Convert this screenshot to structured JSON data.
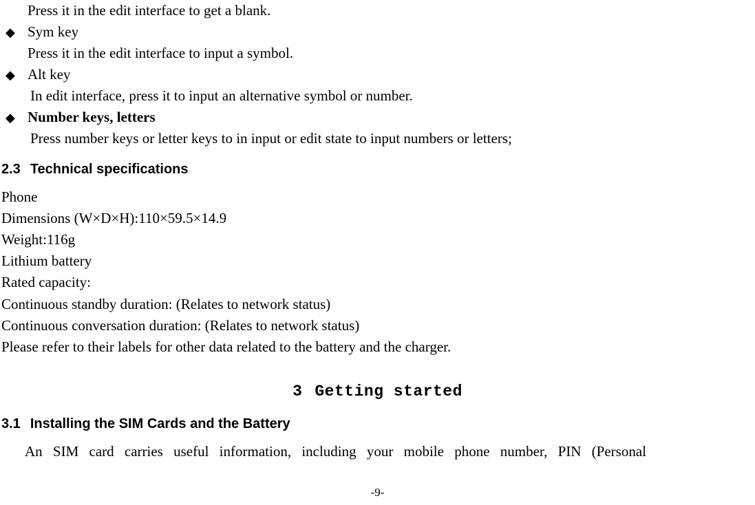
{
  "items": {
    "prev_desc": "Press it in the edit interface to get a blank.",
    "sym_key": {
      "title": "Sym key",
      "desc": "Press it in the edit interface to input a symbol."
    },
    "alt_key": {
      "title": "Alt key",
      "desc": "In edit interface, press it to input an alternative symbol or number."
    },
    "number_keys": {
      "title": "Number keys, letters",
      "desc": "Press number keys or letter keys to in input or edit state to input numbers or letters;"
    }
  },
  "section_2_3": {
    "num": "2.3",
    "title": "Technical specifications",
    "lines": {
      "phone": "Phone",
      "dims": "Dimensions (W×D×H):110×59.5×14.9",
      "weight": "Weight:116g",
      "battery": "Lithium battery",
      "capacity": "Rated capacity:",
      "standby": "Continuous standby duration: (Relates to network status)",
      "conversation": "Continuous conversation duration: (Relates to network status)",
      "refer": "Please refer to their labels for other data related to the battery and the charger."
    }
  },
  "chapter_3": {
    "num": "3",
    "title": "Getting started"
  },
  "section_3_1": {
    "num": "3.1",
    "title": "Installing the SIM Cards and the Battery",
    "body": "An SIM card carries useful information, including your mobile phone number, PIN (Personal"
  },
  "page_number": "-9-",
  "bullet_char": "◆"
}
